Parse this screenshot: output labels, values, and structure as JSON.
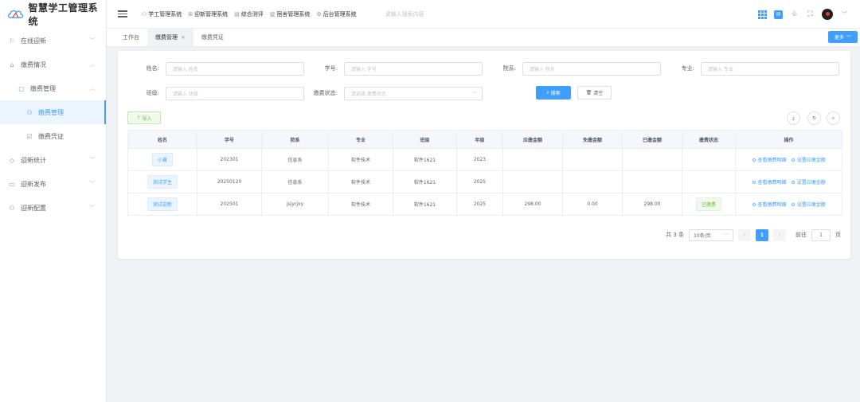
{
  "app": {
    "title": "智慧学工管理系统"
  },
  "sidebar": {
    "items": [
      {
        "label": "在线迎新",
        "icon": "flag-icon",
        "arrow": "﹀"
      },
      {
        "label": "缴费情况",
        "icon": "home-icon",
        "arrow": "︿"
      },
      {
        "label": "缴费管理",
        "icon": "document-icon",
        "arrow": "︿"
      },
      {
        "label": "缴费管理",
        "icon": "user-icon",
        "arrow": ""
      },
      {
        "label": "缴费凭证",
        "icon": "checkbox-icon",
        "arrow": ""
      },
      {
        "label": "迎新统计",
        "icon": "tag-icon",
        "arrow": "﹀"
      },
      {
        "label": "迎新发布",
        "icon": "folder-icon",
        "arrow": "﹀"
      },
      {
        "label": "迎新配置",
        "icon": "user-icon",
        "arrow": "﹀"
      }
    ]
  },
  "topnav": {
    "items": [
      {
        "label": "学工管理系统",
        "icon": "user-icon"
      },
      {
        "label": "迎新管理系统",
        "icon": "org-icon"
      },
      {
        "label": "综合测评",
        "icon": "document-icon"
      },
      {
        "label": "宿舍管理系统",
        "icon": "chart-icon"
      },
      {
        "label": "后台管理系统",
        "icon": "gear-icon"
      }
    ],
    "search_placeholder": "请输入搜索内容"
  },
  "tabs": {
    "items": [
      {
        "label": "工作台"
      },
      {
        "label": "缴费管理",
        "close": "×"
      },
      {
        "label": "缴费凭证"
      }
    ],
    "more_label": "更多"
  },
  "filters": {
    "name": {
      "label": "姓名:",
      "placeholder": "请输入 姓名"
    },
    "student_no": {
      "label": "学号:",
      "placeholder": "请输入 学号"
    },
    "department": {
      "label": "院系:",
      "placeholder": "请输入 院系"
    },
    "major": {
      "label": "专业:",
      "placeholder": "请输入 专业"
    },
    "class": {
      "label": "班级:",
      "placeholder": "请输入 班级"
    },
    "status": {
      "label": "缴费状态:",
      "placeholder": "请选择 缴费状态"
    },
    "search_label": "搜索",
    "clear_label": "清空"
  },
  "toolbar": {
    "import_label": "导入"
  },
  "table": {
    "headers": [
      "姓名",
      "学号",
      "院系",
      "专业",
      "班级",
      "年级",
      "应缴金额",
      "免缴金额",
      "已缴金额",
      "缴费状态",
      "操作"
    ],
    "rows": [
      {
        "name": "小黄",
        "student_no": "202301",
        "department": "信息系",
        "major": "软件技术",
        "class": "软件1621",
        "grade": "2023",
        "due": "",
        "waived": "",
        "paid": "",
        "status": "",
        "op1": "查看缴费明细",
        "op2": "设置应缴金额"
      },
      {
        "name": "测试学生",
        "student_no": "20250120",
        "department": "信息系",
        "major": "软件技术",
        "class": "软件1621",
        "grade": "2025",
        "due": "",
        "waived": "",
        "paid": "",
        "status": "",
        "op1": "查看缴费明细",
        "op2": "设置应缴金额"
      },
      {
        "name": "测试迎新",
        "student_no": "202501",
        "department": "jsjyrjxy",
        "major": "软件技术",
        "class": "软件1621",
        "grade": "2025",
        "due": "298.00",
        "waived": "0.00",
        "paid": "298.00",
        "status": "已缴费",
        "op1": "查看缴费明细",
        "op2": "设置应缴金额"
      }
    ]
  },
  "pagination": {
    "total": "共 3 条",
    "page_size": "10条/页",
    "current": "1",
    "goto_prefix": "前往",
    "goto_value": "1",
    "goto_suffix": "页"
  },
  "colors": {
    "accent": "#409eff",
    "success": "#67c23a",
    "background": "#f0f2f5"
  }
}
